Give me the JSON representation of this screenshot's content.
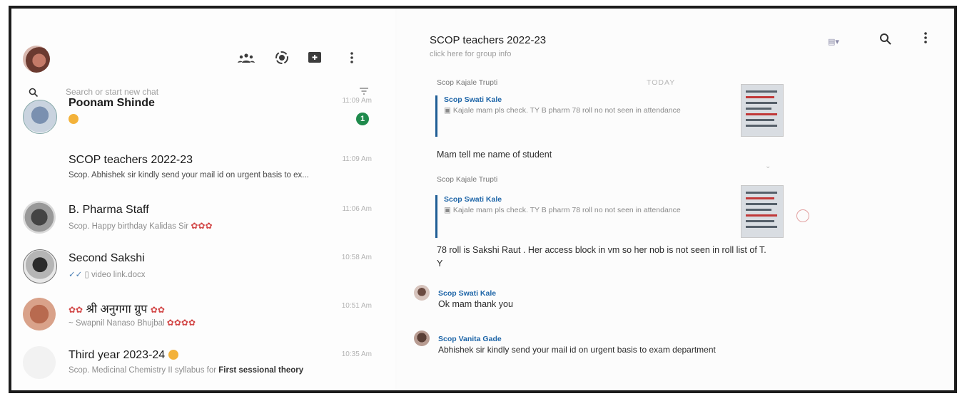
{
  "left": {
    "search": {
      "placeholder": "Search or start new chat"
    },
    "chats": [
      {
        "name": "Poonam Shinde",
        "time": "11:09 Am",
        "preview": "",
        "badge": "1"
      },
      {
        "name": "SCOP teachers 2022-23",
        "time": "11:09 Am",
        "preview": "Scop. Abhishek sir kindly send your mail id on urgent basis to ex...",
        "badge": ""
      },
      {
        "name": "B. Pharma Staff",
        "time": "11:06 Am",
        "preview": "Scop. Happy birthday Kalidas Sir",
        "badge": ""
      },
      {
        "name": "Second Sakshi",
        "time": "10:58 Am",
        "preview": "video link.docx",
        "badge": ""
      },
      {
        "name": "श्री अनुगगा ग्रुप",
        "time": "10:51 Am",
        "preview": "~ Swapnil Nanaso Bhujbal",
        "badge": ""
      },
      {
        "name": "Third year 2023-24",
        "time": "10:35 Am",
        "preview": "Scop. Medicinal Chemistry II syllabus for ",
        "preview_bold": "First sessional theory",
        "badge": ""
      }
    ]
  },
  "right": {
    "title": "SCOP teachers 2022-23",
    "subtitle": "click here for group info",
    "date_divider": "TODAY",
    "messages": [
      {
        "sender": "Scop Kajale Trupti",
        "quote_name": "Scop Swati Kale",
        "quote_text": "Kajale mam pls check. TY B pharm 78 roll no not seen in attendance",
        "text": "Mam tell me name of student",
        "time": ""
      },
      {
        "sender": "Scop Kajale Trupti",
        "quote_name": "Scop Swati Kale",
        "quote_text": "Kajale mam pls check. TY B pharm 78 roll no not seen in attendance",
        "text": "78 roll is Sakshi Raut . Her access block in vm so her nob is not seen in roll list of T. Y",
        "time": ""
      },
      {
        "sender": "Scop Swati Kale",
        "text": "Ok mam thank you",
        "time": ""
      },
      {
        "sender": "Scop Vanita Gade",
        "text": "Abhishek sir kindly send your mail id on urgent basis to exam department",
        "time": ""
      }
    ]
  },
  "colors": {
    "badge": "#1f8a4c",
    "quote_bar": "#1f5d95",
    "sender_blue": "#1f66a8"
  }
}
